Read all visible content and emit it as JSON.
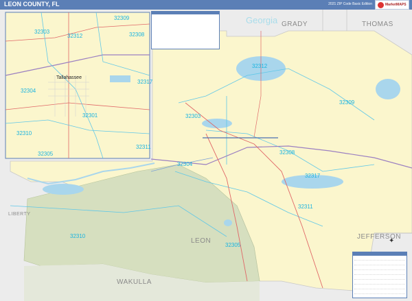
{
  "header": {
    "title": "LEON COUNTY, FL",
    "edition": "2021 ZIP Code Basic Edition",
    "logo_text": "MarketMAPS"
  },
  "labels": {
    "state_georgia": "Georgia",
    "county_grady": "GRADY",
    "county_thomas": "THOMAS",
    "county_leon": "LEON",
    "county_wakulla": "WAKULLA",
    "county_jefferson": "JEFFERSON",
    "county_liberty": "LIBERTY",
    "city_tallahassee": "Tallahassee"
  },
  "zips": {
    "inset_32309": "32309",
    "inset_32303": "32303",
    "inset_32312": "32312",
    "inset_32308": "32308",
    "inset_32317": "32317",
    "inset_32304": "32304",
    "inset_32301": "32301",
    "inset_32310": "32310",
    "inset_32305": "32305",
    "inset_32311": "32311",
    "main_32312": "32312",
    "main_32309": "32309",
    "main_32303": "32303",
    "main_32308": "32308",
    "main_32304": "32304",
    "main_32317": "32317",
    "main_32311": "32311",
    "main_32310": "32310",
    "main_32305": "32305"
  },
  "colors": {
    "header": "#5b7fb6",
    "leon_fill": "#fbf6cd",
    "forest_fill": "#d6dfbf",
    "neighbor_fill": "#ececec",
    "water": "#a9d6ec",
    "zip_label": "#19b3e0",
    "zip_boundary": "#5ec7e8",
    "highway": "#9b7fc1"
  }
}
